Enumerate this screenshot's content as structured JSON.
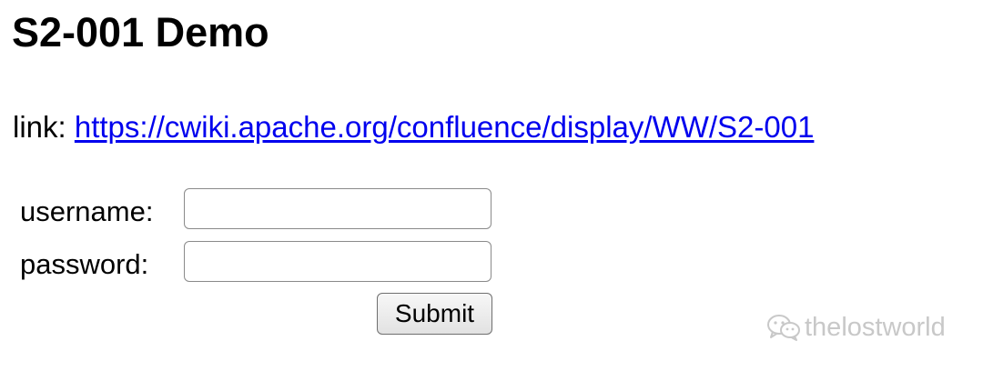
{
  "page": {
    "title": "S2-001 Demo",
    "link_prefix": "link:",
    "link_text": "https://cwiki.apache.org/confluence/display/WW/S2-001",
    "link_href": "https://cwiki.apache.org/confluence/display/WW/S2-001"
  },
  "form": {
    "username_label": "username:",
    "username_value": "",
    "password_label": "password:",
    "password_value": "",
    "submit_label": "Submit"
  },
  "watermark": {
    "icon": "wechat-icon",
    "text": "thelostworld"
  },
  "colors": {
    "link": "#0000ee",
    "watermark": "#c8c8c8"
  }
}
